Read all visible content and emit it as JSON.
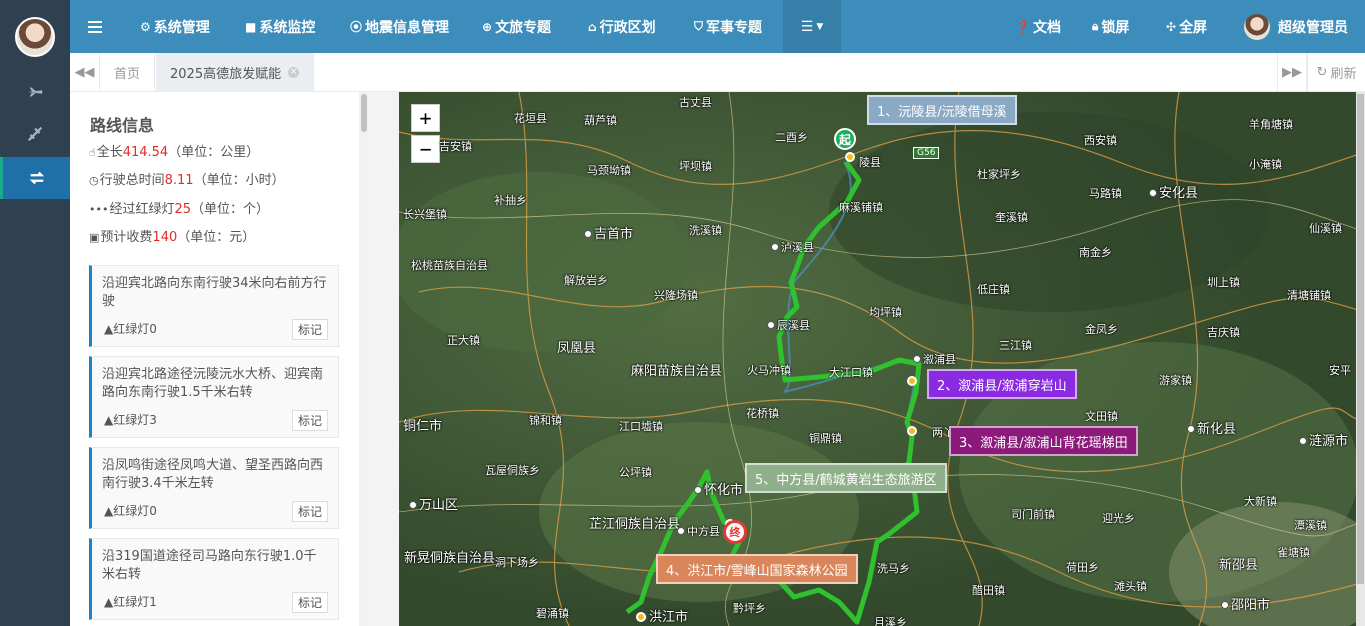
{
  "nav": {
    "items": [
      {
        "icon": "gear-icon",
        "label": "系统管理"
      },
      {
        "icon": "video-icon",
        "label": "系统监控"
      },
      {
        "icon": "map-pin-icon",
        "label": "地震信息管理"
      },
      {
        "icon": "globe-icon",
        "label": "文旅专题"
      },
      {
        "icon": "bank-icon",
        "label": "行政区划"
      },
      {
        "icon": "shield-icon",
        "label": "军事专题"
      }
    ],
    "right": [
      {
        "icon": "question-icon",
        "label": "文档"
      },
      {
        "icon": "lock-icon",
        "label": "锁屏"
      },
      {
        "icon": "fullscreen-icon",
        "label": "全屏"
      }
    ],
    "user": "超级管理员"
  },
  "tabs": {
    "home": "首页",
    "active": "2025高德旅发赋能",
    "refresh": "刷新"
  },
  "route": {
    "title": "路线信息",
    "stats": [
      {
        "prefix": "全长",
        "value": "414.54",
        "unit": "（单位：公里）"
      },
      {
        "prefix": "行驶总时间",
        "value": "8.11",
        "unit": "（单位：小时）"
      },
      {
        "prefix": "经过红绿灯",
        "value": "25",
        "unit": "（单位：个）"
      },
      {
        "prefix": "预计收费",
        "value": "140",
        "unit": "（单位：元）"
      }
    ],
    "mark_label": "标记",
    "steps": [
      {
        "text": "沿迎宾北路向东南行驶34米向右前方行驶",
        "lights": "红绿灯0"
      },
      {
        "text": "沿迎宾北路途径沅陵沅水大桥、迎宾南路向东南行驶1.5千米右转",
        "lights": "红绿灯3"
      },
      {
        "text": "沿凤鸣街途径凤鸣大道、望圣西路向西南行驶3.4千米左转",
        "lights": "红绿灯0"
      },
      {
        "text": "沿319国道途径司马路向东行驶1.0千米右转",
        "lights": "红绿灯1"
      }
    ]
  },
  "map": {
    "zoom_in": "+",
    "zoom_out": "−",
    "start_label": "起",
    "end_label": "终",
    "route_color": "#2fc12f",
    "pois": [
      {
        "label": "1、沅陵县/沅陵借母溪",
        "color": "#8aa9c5"
      },
      {
        "label": "2、溆浦县/溆浦穿岩山",
        "color": "#8a2be2"
      },
      {
        "label": "3、溆浦县/溆浦山背花瑶梯田",
        "color": "#8b1a7a"
      },
      {
        "label": "5、中方县/鹤城黄岩生态旅游区",
        "color": "#8fb08a"
      },
      {
        "label": "4、洪江市/雪峰山国家森林公园",
        "color": "#d9875a"
      }
    ],
    "highways": [
      "G56"
    ],
    "places": [
      "古丈县",
      "花垣县",
      "葫芦镇",
      "二酉乡",
      "西安镇",
      "羊角塘镇",
      "吉安镇",
      "马颈坳镇",
      "坪坝镇",
      "陵县",
      "杜家坪乡",
      "小淹镇",
      "补抽乡",
      "马路镇",
      "安化县",
      "长兴堡镇",
      "麻溪铺镇",
      "奎溪镇",
      "仙溪镇",
      "吉首市",
      "洗溪镇",
      "泸溪县",
      "南金乡",
      "松桃苗族自治县",
      "解放岩乡",
      "兴隆场镇",
      "低庄镇",
      "圳上镇",
      "清塘铺镇",
      "均坪镇",
      "辰溪县",
      "金凤乡",
      "吉庆镇",
      "正大镇",
      "凤凰县",
      "麻阳苗族自治县",
      "三江镇",
      "溆浦县",
      "安平",
      "游家镇",
      "火马冲镇",
      "大江口镇",
      "花桥镇",
      "文田镇",
      "新化县",
      "锦和镇",
      "江口墟镇",
      "铜仁市",
      "铜鼎镇",
      "两丫坪镇",
      "涟源市",
      "瓦屋侗族乡",
      "公坪镇",
      "万山区",
      "怀化市",
      "大新镇",
      "芷江侗族自治县",
      "中方县",
      "司门前镇",
      "迎光乡",
      "潭溪镇",
      "新晃侗族自治县",
      "洞下场乡",
      "雀塘镇",
      "洗马乡",
      "荷田乡",
      "新邵县",
      "碧涌镇",
      "洪江市",
      "黔坪乡",
      "醋田镇",
      "滩头镇",
      "邵阳市",
      "月溪乡"
    ]
  }
}
